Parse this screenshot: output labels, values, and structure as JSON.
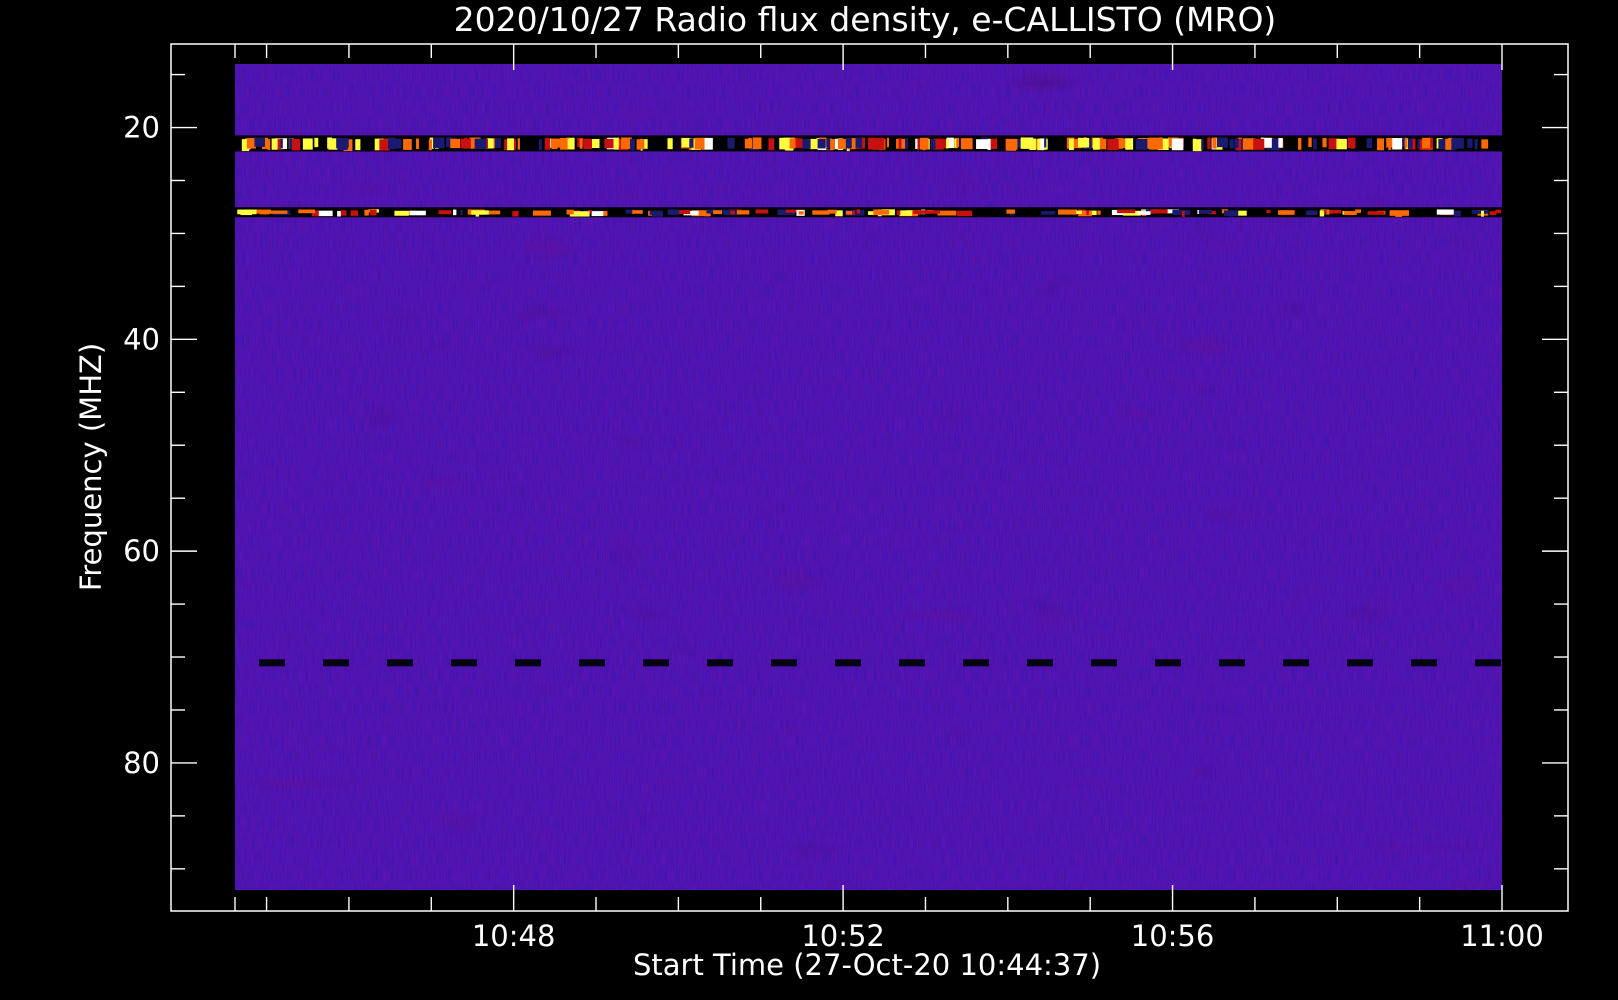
{
  "chart_data": {
    "type": "heatmap",
    "title": "2020/10/27  Radio flux density, e-CALLISTO (MRO)",
    "xlabel": "Start Time (27-Oct-20 10:44:37)",
    "ylabel": "Frequency (MHZ)",
    "x_range": [
      "10:44:37",
      "11:00:00"
    ],
    "x_major_ticks": [
      "10:48",
      "10:52",
      "10:56",
      "11:00"
    ],
    "x_minor_tick_step_minutes": 1,
    "y_range_mhz": [
      14,
      92
    ],
    "y_major_ticks": [
      20,
      40,
      60,
      80
    ],
    "y_minor_tick_step_mhz": 5,
    "y_inverted": true,
    "colormap": [
      "#000000",
      "#2020ff",
      "#ff0000",
      "#ffff00",
      "#ffffff"
    ],
    "background_color": "#2a1ee0",
    "features": [
      {
        "kind": "bright_band",
        "freq_mhz": 21.5,
        "intensity": "high"
      },
      {
        "kind": "bright_band",
        "freq_mhz": 28.0,
        "intensity": "medium"
      },
      {
        "kind": "dark_dashed_line",
        "freq_mhz": 70.5
      }
    ]
  }
}
